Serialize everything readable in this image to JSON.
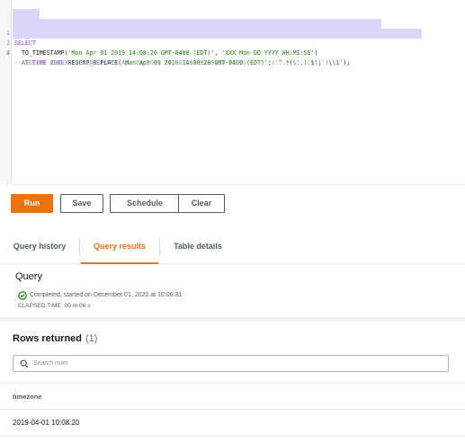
{
  "editor": {
    "lines": [
      {
        "number": "1",
        "parts": [
          {
            "t": "SELECT",
            "c": "kw"
          }
        ]
      },
      {
        "number": "2",
        "parts": [
          {
            "t": "  TO_TIMESTAMP(",
            "c": "plain"
          },
          {
            "t": "'Mon Apr 01 2019 14:08:20 GMT-0400 (EDT)'",
            "c": "str"
          },
          {
            "t": ", ",
            "c": "plain"
          },
          {
            "t": "'XXX Mon DD YYYY HH:MI:SS'",
            "c": "str"
          },
          {
            "t": ")",
            "c": "plain"
          }
        ]
      },
      {
        "number": "3",
        "parts": [
          {
            "t": "  AT TIME ZONE ",
            "c": "kw"
          },
          {
            "t": "REGEXP_REPLACE(",
            "c": "plain"
          },
          {
            "t": "'Mon Apr 01 2019 14:08:20 GMT-0400 (EDT)'",
            "c": "str"
          },
          {
            "t": ", ",
            "c": "plain"
          },
          {
            "t": "'^.*(...).$'",
            "c": "str"
          },
          {
            "t": ", ",
            "c": "plain"
          },
          {
            "t": "'\\\\1'",
            "c": "str"
          },
          {
            "t": ");",
            "c": "plain"
          }
        ]
      },
      {
        "number": "4",
        "parts": [
          {
            "t": "-- SELECT REGEXP_REPLACE('Mon Apr 01 2019 14:08:20 GMT-0400 (EDT)', '^.*(...).$', '\\\\1');",
            "c": "comment"
          }
        ]
      }
    ]
  },
  "toolbar": {
    "run_label": "Run",
    "save_label": "Save",
    "schedule_label": "Schedule",
    "clear_label": "Clear"
  },
  "tabs": [
    {
      "label": "Query history",
      "active": false
    },
    {
      "label": "Query results",
      "active": true
    },
    {
      "label": "Table details",
      "active": false
    }
  ],
  "query": {
    "title": "Query",
    "status_icon": "check-circle-icon",
    "status_text": "Completed, started on December 01, 2020 at 10:06:31",
    "elapsed": "ELAPSED TIME: 00 m 06 s"
  },
  "rows": {
    "title": "Rows returned",
    "count": "(1)",
    "search_placeholder": "Search rows",
    "search_icon": "search-icon",
    "columns": [
      "timezone"
    ],
    "data": [
      [
        "2019-04-01 10:08:20"
      ]
    ]
  },
  "colors": {
    "primary": "#ec7211",
    "selection": "#ddd6fb",
    "keyword": "#8a3fe0",
    "string": "#1d8102",
    "success": "#1d8102"
  }
}
